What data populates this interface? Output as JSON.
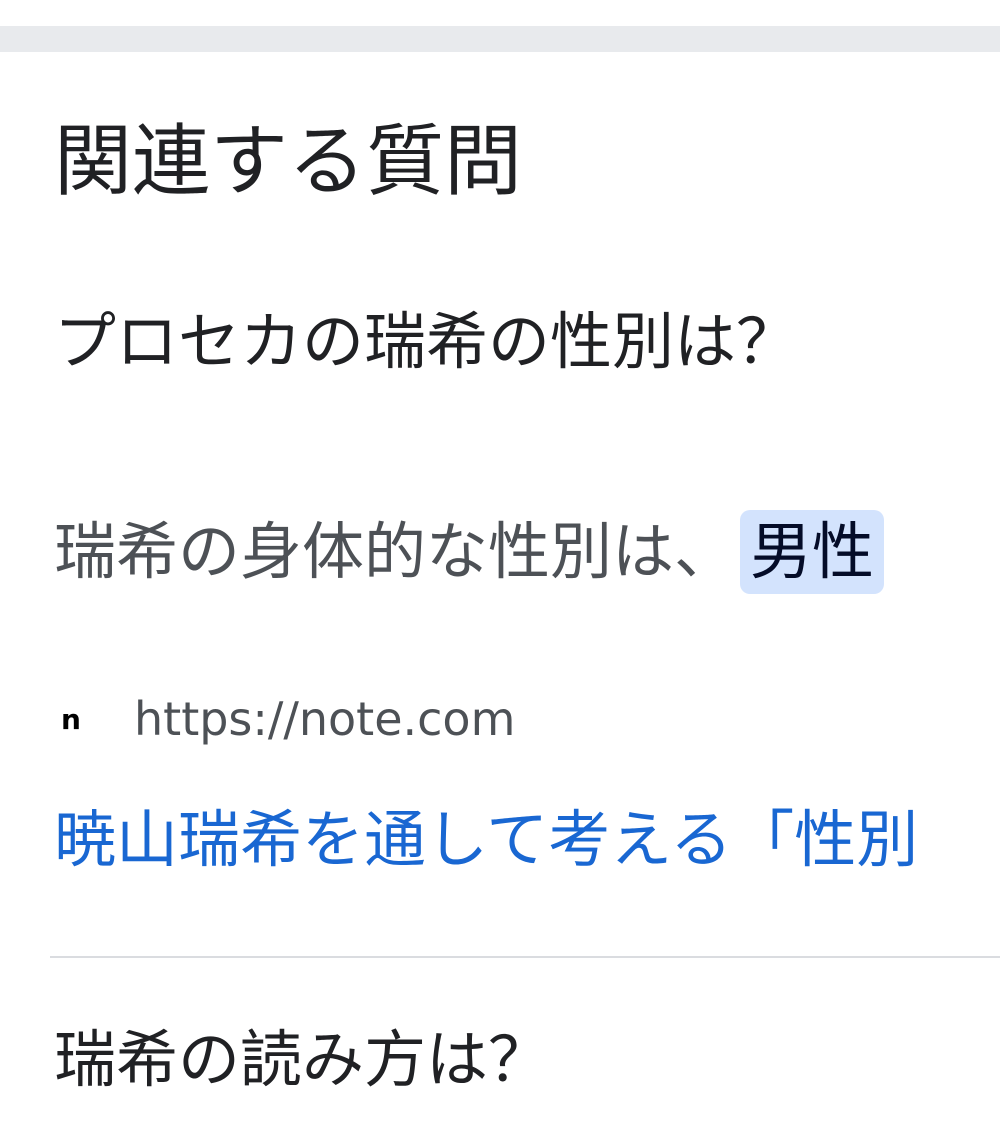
{
  "related_questions": {
    "title": "関連する質問",
    "items": [
      {
        "question": "プロセカの瑞希の性別は？",
        "answer_prefix": "瑞希の身体的な性別は、",
        "answer_highlight": "男性",
        "source_favicon": "n",
        "source_url": "https://note.com",
        "link_title": "暁山瑞希を通して考える「性別"
      },
      {
        "question": "瑞希の読み方は？"
      }
    ]
  },
  "colors": {
    "divider_band": "#e8eaed",
    "highlight_bg": "#d3e3fd",
    "link": "#1967d2",
    "text_primary": "#202124",
    "text_secondary": "#4d5156"
  }
}
